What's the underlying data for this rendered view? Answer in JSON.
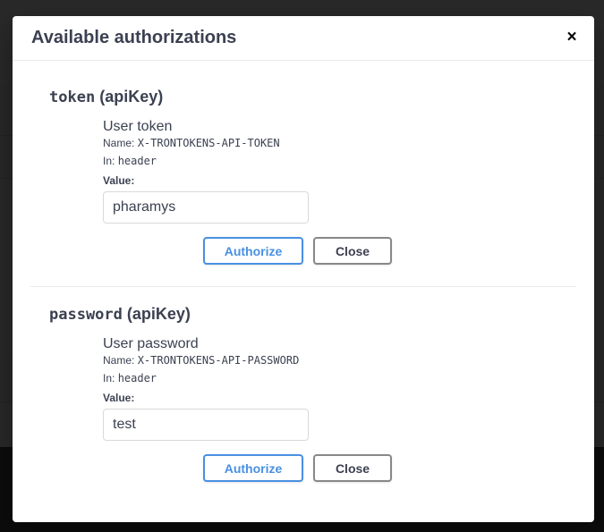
{
  "modal": {
    "title": "Available authorizations",
    "close_symbol": "×"
  },
  "auths": [
    {
      "name": "token",
      "type": "(apiKey)",
      "description": "User token",
      "name_label": "Name:",
      "header_name": "X-TRONTOKENS-API-TOKEN",
      "in_label": "In:",
      "in_value": "header",
      "value_label": "Value:",
      "value": "pharamys",
      "authorize_label": "Authorize",
      "close_label": "Close"
    },
    {
      "name": "password",
      "type": "(apiKey)",
      "description": "User password",
      "name_label": "Name:",
      "header_name": "X-TRONTOKENS-API-PASSWORD",
      "in_label": "In:",
      "in_value": "header",
      "value_label": "Value:",
      "value": "test",
      "authorize_label": "Authorize",
      "close_label": "Close"
    }
  ],
  "colors": {
    "authorize_accent": "#4990e2",
    "text": "#3b4151"
  }
}
